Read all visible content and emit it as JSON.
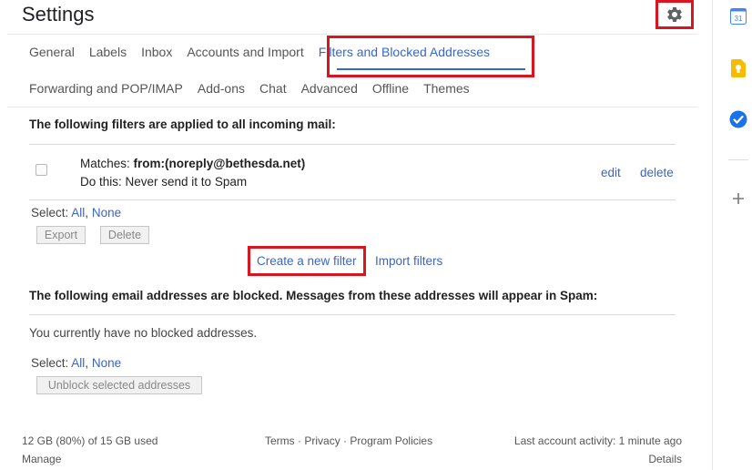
{
  "header": {
    "title": "Settings",
    "gear_icon": "gear-icon"
  },
  "tabs_row1": [
    "General",
    "Labels",
    "Inbox",
    "Accounts and Import",
    "Filters and Blocked Addresses"
  ],
  "tabs_row2": [
    "Forwarding and POP/IMAP",
    "Add-ons",
    "Chat",
    "Advanced",
    "Offline",
    "Themes"
  ],
  "filters": {
    "heading": "The following filters are applied to all incoming mail:",
    "item": {
      "matches_label": "Matches:",
      "matches_value": "from:(noreply@bethesda.net)",
      "action": "Do this: Never send it to Spam",
      "edit": "edit",
      "delete": "delete"
    },
    "select_label": "Select:",
    "select_all": "All",
    "select_sep": ",",
    "select_none": "None",
    "export": "Export",
    "delete_button": "Delete",
    "create_filter": "Create a new filter",
    "import_filters": "Import filters"
  },
  "blocked": {
    "heading": "The following email addresses are blocked. Messages from these addresses will appear in Spam:",
    "empty": "You currently have no blocked addresses.",
    "select_label": "Select:",
    "select_all": "All",
    "select_sep": ",",
    "select_none": "None",
    "unblock": "Unblock selected addresses"
  },
  "footer": {
    "storage": "12 GB (80%) of 15 GB used",
    "manage": "Manage",
    "terms": "Terms",
    "sep1": "·",
    "privacy": "Privacy",
    "sep2": "·",
    "policies": "Program Policies",
    "activity": "Last account activity: 1 minute ago",
    "details": "Details"
  },
  "sidebar": {
    "calendar_label": "31",
    "icons": [
      "calendar-icon",
      "keep-icon",
      "tasks-icon",
      "add-icon"
    ]
  },
  "colors": {
    "accent": "#3367d6",
    "highlight": "#d9161f",
    "link": "#3d64c1"
  }
}
